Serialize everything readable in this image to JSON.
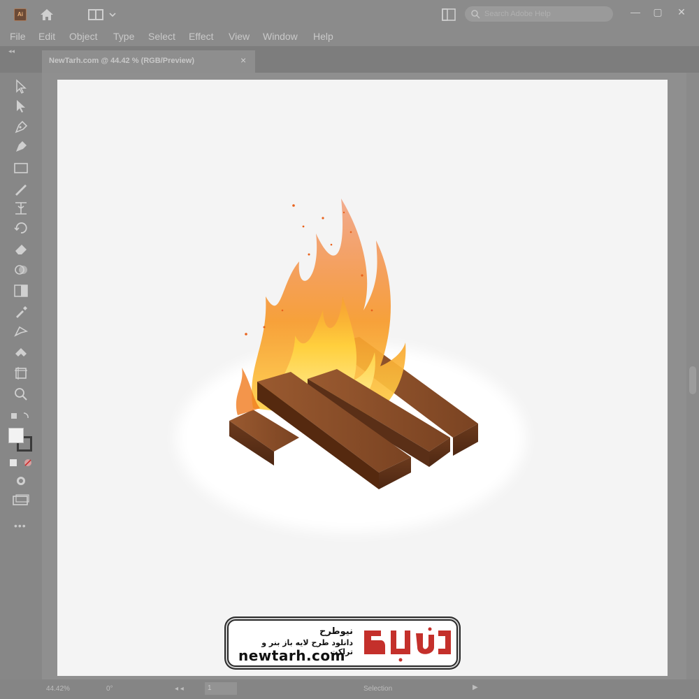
{
  "app": {
    "logo_text": "Ai",
    "search_placeholder": "Search Adobe Help",
    "window_controls": [
      "—",
      "▢",
      "✕"
    ]
  },
  "menu": [
    "File",
    "Edit",
    "Object",
    "Type",
    "Select",
    "Effect",
    "View",
    "Window",
    "Help"
  ],
  "document_tab": {
    "title": "NewTarh.com @ 44.42 % (RGB/Preview)",
    "close": "×"
  },
  "toolbar": {
    "collapse": "◂◂",
    "tools": [
      "selection-tool-icon",
      "direct-selection-tool-icon",
      "pen-tool-icon",
      "curvature-tool-icon",
      "rectangle-tool-icon",
      "paintbrush-tool-icon",
      "width-tool-icon",
      "rotate-tool-icon",
      "eraser-tool-icon",
      "shape-builder-tool-icon",
      "gradient-tool-icon",
      "eyedropper-tool-icon",
      "blend-tool-icon",
      "symbol-sprayer-tool-icon",
      "artboard-tool-icon",
      "zoom-tool-icon"
    ],
    "more": "•••"
  },
  "status": {
    "zoom": "44.42%",
    "rotation": "0°",
    "artboard_number": "1",
    "tool_name": "Selection"
  },
  "watermark": {
    "title": "نیوطرح",
    "subtitle": "دانلود طرح لایه باز بنر و تراکت",
    "url": "newtarh.com",
    "logo_word": "نیوطرح",
    "colors": {
      "logo": "#c4302b",
      "text": "#111111"
    }
  },
  "colors": {
    "ui_gray": "#8b8b8b",
    "artboard": "#f4f4f4",
    "flame_orange": "#f07a1e",
    "flame_yellow": "#ffd34a",
    "wood": "#7a4524"
  }
}
